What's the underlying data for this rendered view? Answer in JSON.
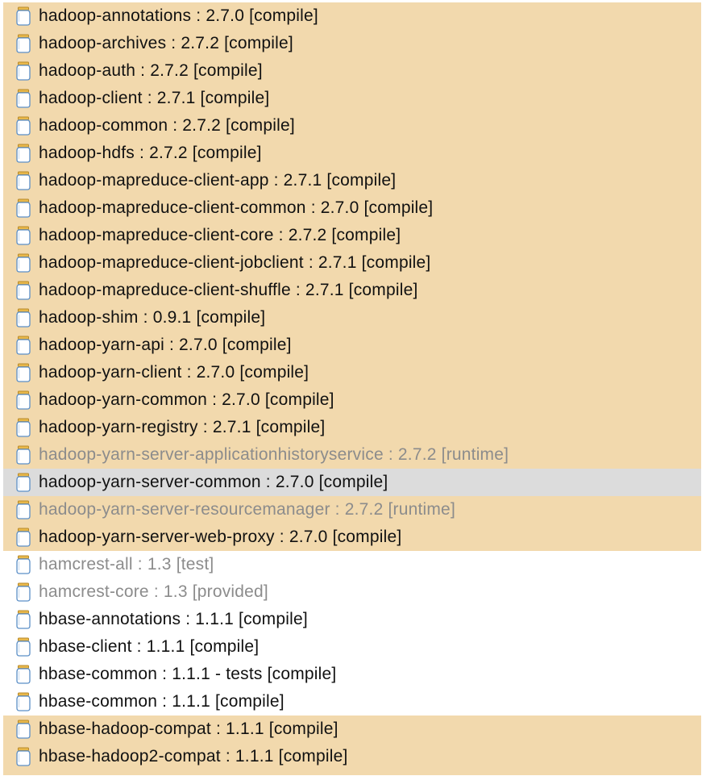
{
  "tree": {
    "items": [
      {
        "label": "hadoop-annotations : 2.7.0 [compile]",
        "state": "highlight",
        "dim": false
      },
      {
        "label": "hadoop-archives : 2.7.2 [compile]",
        "state": "highlight",
        "dim": false
      },
      {
        "label": "hadoop-auth : 2.7.2 [compile]",
        "state": "highlight",
        "dim": false
      },
      {
        "label": "hadoop-client : 2.7.1 [compile]",
        "state": "highlight",
        "dim": false
      },
      {
        "label": "hadoop-common : 2.7.2 [compile]",
        "state": "highlight",
        "dim": false
      },
      {
        "label": "hadoop-hdfs : 2.7.2 [compile]",
        "state": "highlight",
        "dim": false
      },
      {
        "label": "hadoop-mapreduce-client-app : 2.7.1 [compile]",
        "state": "highlight",
        "dim": false
      },
      {
        "label": "hadoop-mapreduce-client-common : 2.7.0 [compile]",
        "state": "highlight",
        "dim": false
      },
      {
        "label": "hadoop-mapreduce-client-core : 2.7.2 [compile]",
        "state": "highlight",
        "dim": false
      },
      {
        "label": "hadoop-mapreduce-client-jobclient : 2.7.1 [compile]",
        "state": "highlight",
        "dim": false
      },
      {
        "label": "hadoop-mapreduce-client-shuffle : 2.7.1 [compile]",
        "state": "highlight",
        "dim": false
      },
      {
        "label": "hadoop-shim : 0.9.1 [compile]",
        "state": "highlight",
        "dim": false
      },
      {
        "label": "hadoop-yarn-api : 2.7.0 [compile]",
        "state": "highlight",
        "dim": false
      },
      {
        "label": "hadoop-yarn-client : 2.7.0 [compile]",
        "state": "highlight",
        "dim": false
      },
      {
        "label": "hadoop-yarn-common : 2.7.0 [compile]",
        "state": "highlight",
        "dim": false
      },
      {
        "label": "hadoop-yarn-registry : 2.7.1 [compile]",
        "state": "highlight",
        "dim": false
      },
      {
        "label": "hadoop-yarn-server-applicationhistoryservice : 2.7.2 [runtime]",
        "state": "highlight",
        "dim": true
      },
      {
        "label": "hadoop-yarn-server-common : 2.7.0 [compile]",
        "state": "selected",
        "dim": false
      },
      {
        "label": "hadoop-yarn-server-resourcemanager : 2.7.2 [runtime]",
        "state": "highlight",
        "dim": true
      },
      {
        "label": "hadoop-yarn-server-web-proxy : 2.7.0 [compile]",
        "state": "highlight",
        "dim": false
      },
      {
        "label": "hamcrest-all : 1.3 [test]",
        "state": "normal",
        "dim": true
      },
      {
        "label": "hamcrest-core : 1.3 [provided]",
        "state": "normal",
        "dim": true
      },
      {
        "label": "hbase-annotations : 1.1.1 [compile]",
        "state": "normal",
        "dim": false
      },
      {
        "label": "hbase-client : 1.1.1 [compile]",
        "state": "normal",
        "dim": false
      },
      {
        "label": "hbase-common : 1.1.1 - tests [compile]",
        "state": "normal",
        "dim": false
      },
      {
        "label": "hbase-common : 1.1.1 [compile]",
        "state": "normal",
        "dim": false
      },
      {
        "label": "hbase-hadoop-compat : 1.1.1 [compile]",
        "state": "highlight",
        "dim": false
      },
      {
        "label": "hbase-hadoop2-compat : 1.1.1 [compile]",
        "state": "highlight",
        "dim": false
      }
    ],
    "icon": "jar-icon",
    "colors": {
      "highlight": "#f2d9ad",
      "selected": "#dcdcdc",
      "text": "#111111",
      "dim_text": "#8c8c8c"
    }
  }
}
